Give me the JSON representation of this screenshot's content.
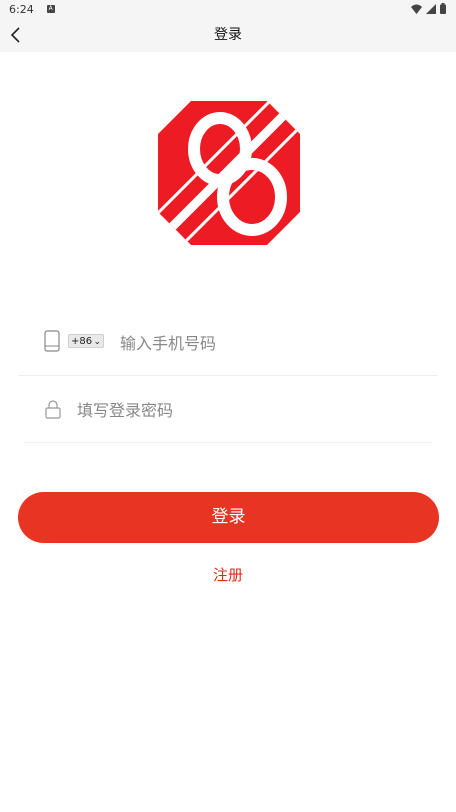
{
  "status_bar": {
    "time": "6:24",
    "notification_icon": "a-icon"
  },
  "nav": {
    "title": "登录"
  },
  "form": {
    "country_code": "+86",
    "phone_placeholder": "输入手机号码",
    "password_placeholder": "填写登录密码"
  },
  "actions": {
    "login_label": "登录",
    "register_label": "注册"
  },
  "colors": {
    "brand_red": "#e83423",
    "logo_red": "#ed1c24",
    "link_red": "#e0291d"
  }
}
